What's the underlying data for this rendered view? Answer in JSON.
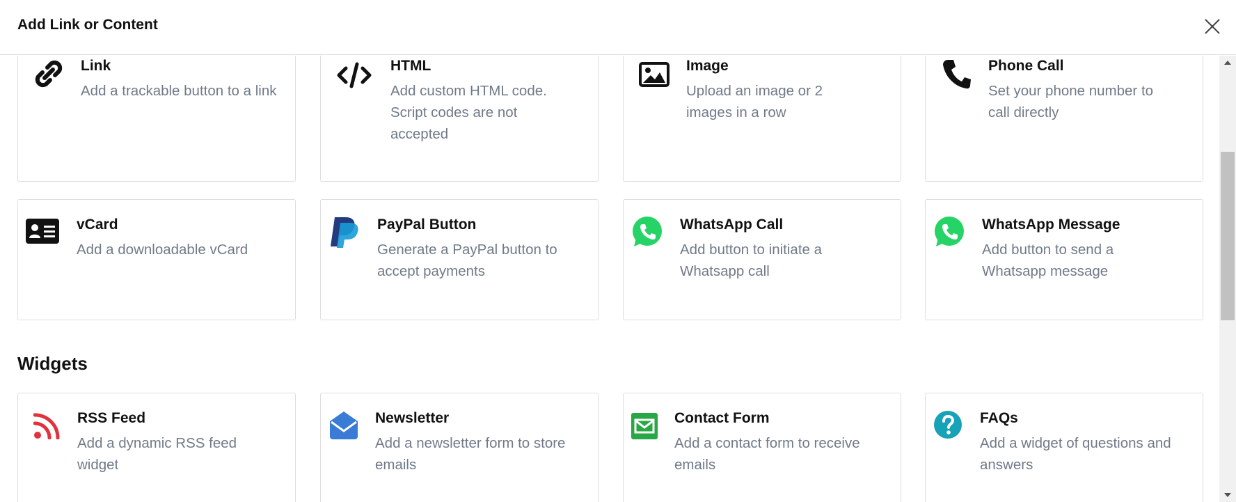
{
  "modal": {
    "title": "Add Link or Content"
  },
  "sections": {
    "widgets_heading": "Widgets"
  },
  "cards": {
    "link": {
      "title": "Link",
      "desc": "Add a trackable button to a link",
      "icon": "link-icon"
    },
    "html": {
      "title": "HTML",
      "desc": "Add custom HTML code. Script codes are not accepted",
      "icon": "code-icon"
    },
    "image": {
      "title": "Image",
      "desc": "Upload an image or 2 images in a row",
      "icon": "image-icon"
    },
    "phone": {
      "title": "Phone Call",
      "desc": "Set your phone number to call directly",
      "icon": "phone-icon"
    },
    "vcard": {
      "title": "vCard",
      "desc": "Add a downloadable vCard",
      "icon": "id-card-icon"
    },
    "paypal": {
      "title": "PayPal Button",
      "desc": "Generate a PayPal button to accept payments",
      "icon": "paypal-icon"
    },
    "whatsapp_call": {
      "title": "WhatsApp Call",
      "desc": "Add button to initiate a Whatsapp call",
      "icon": "whatsapp-icon"
    },
    "whatsapp_message": {
      "title": "WhatsApp Message",
      "desc": "Add button to send a Whatsapp message",
      "icon": "whatsapp-icon"
    },
    "rss": {
      "title": "RSS Feed",
      "desc": "Add a dynamic RSS feed widget",
      "icon": "rss-icon"
    },
    "newsletter": {
      "title": "Newsletter",
      "desc": "Add a newsletter form to store emails",
      "icon": "envelope-open-icon"
    },
    "contact": {
      "title": "Contact Form",
      "desc": "Add a contact form to receive emails",
      "icon": "envelope-icon"
    },
    "faqs": {
      "title": "FAQs",
      "desc": "Add a widget of questions and answers",
      "icon": "question-circle-icon"
    }
  },
  "colors": {
    "whatsapp": "#25d366",
    "rss": "#e0333e",
    "newsletter": "#3a7bd5",
    "contact": "#28a745",
    "faqs": "#17a2b8",
    "paypal_dark": "#253b80",
    "paypal_light": "#179bd7",
    "desc_text": "#707a88"
  }
}
